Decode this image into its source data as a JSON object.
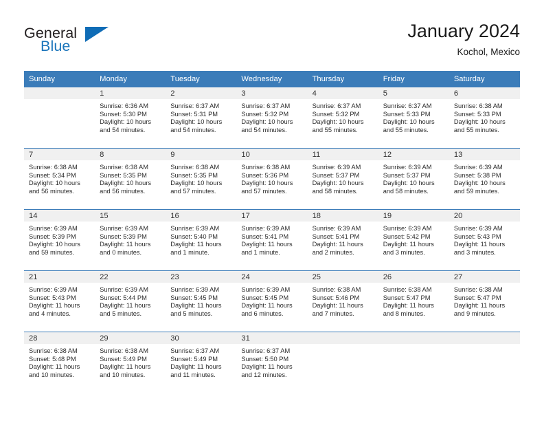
{
  "brand": {
    "name_part1": "General",
    "name_part2": "Blue",
    "logo_icon": "blue-triangle-icon"
  },
  "header": {
    "title": "January 2024",
    "subtitle": "Kochol, Mexico"
  },
  "calendar": {
    "weekday_headers": [
      "Sunday",
      "Monday",
      "Tuesday",
      "Wednesday",
      "Thursday",
      "Friday",
      "Saturday"
    ],
    "accent_color": "#3b7cb9",
    "daynum_band_color": "#f0f0f0",
    "weeks": [
      [
        {
          "day": "",
          "sunrise": "",
          "sunset": "",
          "daylight1": "",
          "daylight2": ""
        },
        {
          "day": "1",
          "sunrise": "Sunrise: 6:36 AM",
          "sunset": "Sunset: 5:30 PM",
          "daylight1": "Daylight: 10 hours",
          "daylight2": "and 54 minutes."
        },
        {
          "day": "2",
          "sunrise": "Sunrise: 6:37 AM",
          "sunset": "Sunset: 5:31 PM",
          "daylight1": "Daylight: 10 hours",
          "daylight2": "and 54 minutes."
        },
        {
          "day": "3",
          "sunrise": "Sunrise: 6:37 AM",
          "sunset": "Sunset: 5:32 PM",
          "daylight1": "Daylight: 10 hours",
          "daylight2": "and 54 minutes."
        },
        {
          "day": "4",
          "sunrise": "Sunrise: 6:37 AM",
          "sunset": "Sunset: 5:32 PM",
          "daylight1": "Daylight: 10 hours",
          "daylight2": "and 55 minutes."
        },
        {
          "day": "5",
          "sunrise": "Sunrise: 6:37 AM",
          "sunset": "Sunset: 5:33 PM",
          "daylight1": "Daylight: 10 hours",
          "daylight2": "and 55 minutes."
        },
        {
          "day": "6",
          "sunrise": "Sunrise: 6:38 AM",
          "sunset": "Sunset: 5:33 PM",
          "daylight1": "Daylight: 10 hours",
          "daylight2": "and 55 minutes."
        }
      ],
      [
        {
          "day": "7",
          "sunrise": "Sunrise: 6:38 AM",
          "sunset": "Sunset: 5:34 PM",
          "daylight1": "Daylight: 10 hours",
          "daylight2": "and 56 minutes."
        },
        {
          "day": "8",
          "sunrise": "Sunrise: 6:38 AM",
          "sunset": "Sunset: 5:35 PM",
          "daylight1": "Daylight: 10 hours",
          "daylight2": "and 56 minutes."
        },
        {
          "day": "9",
          "sunrise": "Sunrise: 6:38 AM",
          "sunset": "Sunset: 5:35 PM",
          "daylight1": "Daylight: 10 hours",
          "daylight2": "and 57 minutes."
        },
        {
          "day": "10",
          "sunrise": "Sunrise: 6:38 AM",
          "sunset": "Sunset: 5:36 PM",
          "daylight1": "Daylight: 10 hours",
          "daylight2": "and 57 minutes."
        },
        {
          "day": "11",
          "sunrise": "Sunrise: 6:39 AM",
          "sunset": "Sunset: 5:37 PM",
          "daylight1": "Daylight: 10 hours",
          "daylight2": "and 58 minutes."
        },
        {
          "day": "12",
          "sunrise": "Sunrise: 6:39 AM",
          "sunset": "Sunset: 5:37 PM",
          "daylight1": "Daylight: 10 hours",
          "daylight2": "and 58 minutes."
        },
        {
          "day": "13",
          "sunrise": "Sunrise: 6:39 AM",
          "sunset": "Sunset: 5:38 PM",
          "daylight1": "Daylight: 10 hours",
          "daylight2": "and 59 minutes."
        }
      ],
      [
        {
          "day": "14",
          "sunrise": "Sunrise: 6:39 AM",
          "sunset": "Sunset: 5:39 PM",
          "daylight1": "Daylight: 10 hours",
          "daylight2": "and 59 minutes."
        },
        {
          "day": "15",
          "sunrise": "Sunrise: 6:39 AM",
          "sunset": "Sunset: 5:39 PM",
          "daylight1": "Daylight: 11 hours",
          "daylight2": "and 0 minutes."
        },
        {
          "day": "16",
          "sunrise": "Sunrise: 6:39 AM",
          "sunset": "Sunset: 5:40 PM",
          "daylight1": "Daylight: 11 hours",
          "daylight2": "and 1 minute."
        },
        {
          "day": "17",
          "sunrise": "Sunrise: 6:39 AM",
          "sunset": "Sunset: 5:41 PM",
          "daylight1": "Daylight: 11 hours",
          "daylight2": "and 1 minute."
        },
        {
          "day": "18",
          "sunrise": "Sunrise: 6:39 AM",
          "sunset": "Sunset: 5:41 PM",
          "daylight1": "Daylight: 11 hours",
          "daylight2": "and 2 minutes."
        },
        {
          "day": "19",
          "sunrise": "Sunrise: 6:39 AM",
          "sunset": "Sunset: 5:42 PM",
          "daylight1": "Daylight: 11 hours",
          "daylight2": "and 3 minutes."
        },
        {
          "day": "20",
          "sunrise": "Sunrise: 6:39 AM",
          "sunset": "Sunset: 5:43 PM",
          "daylight1": "Daylight: 11 hours",
          "daylight2": "and 3 minutes."
        }
      ],
      [
        {
          "day": "21",
          "sunrise": "Sunrise: 6:39 AM",
          "sunset": "Sunset: 5:43 PM",
          "daylight1": "Daylight: 11 hours",
          "daylight2": "and 4 minutes."
        },
        {
          "day": "22",
          "sunrise": "Sunrise: 6:39 AM",
          "sunset": "Sunset: 5:44 PM",
          "daylight1": "Daylight: 11 hours",
          "daylight2": "and 5 minutes."
        },
        {
          "day": "23",
          "sunrise": "Sunrise: 6:39 AM",
          "sunset": "Sunset: 5:45 PM",
          "daylight1": "Daylight: 11 hours",
          "daylight2": "and 5 minutes."
        },
        {
          "day": "24",
          "sunrise": "Sunrise: 6:39 AM",
          "sunset": "Sunset: 5:45 PM",
          "daylight1": "Daylight: 11 hours",
          "daylight2": "and 6 minutes."
        },
        {
          "day": "25",
          "sunrise": "Sunrise: 6:38 AM",
          "sunset": "Sunset: 5:46 PM",
          "daylight1": "Daylight: 11 hours",
          "daylight2": "and 7 minutes."
        },
        {
          "day": "26",
          "sunrise": "Sunrise: 6:38 AM",
          "sunset": "Sunset: 5:47 PM",
          "daylight1": "Daylight: 11 hours",
          "daylight2": "and 8 minutes."
        },
        {
          "day": "27",
          "sunrise": "Sunrise: 6:38 AM",
          "sunset": "Sunset: 5:47 PM",
          "daylight1": "Daylight: 11 hours",
          "daylight2": "and 9 minutes."
        }
      ],
      [
        {
          "day": "28",
          "sunrise": "Sunrise: 6:38 AM",
          "sunset": "Sunset: 5:48 PM",
          "daylight1": "Daylight: 11 hours",
          "daylight2": "and 10 minutes."
        },
        {
          "day": "29",
          "sunrise": "Sunrise: 6:38 AM",
          "sunset": "Sunset: 5:49 PM",
          "daylight1": "Daylight: 11 hours",
          "daylight2": "and 10 minutes."
        },
        {
          "day": "30",
          "sunrise": "Sunrise: 6:37 AM",
          "sunset": "Sunset: 5:49 PM",
          "daylight1": "Daylight: 11 hours",
          "daylight2": "and 11 minutes."
        },
        {
          "day": "31",
          "sunrise": "Sunrise: 6:37 AM",
          "sunset": "Sunset: 5:50 PM",
          "daylight1": "Daylight: 11 hours",
          "daylight2": "and 12 minutes."
        },
        {
          "day": "",
          "sunrise": "",
          "sunset": "",
          "daylight1": "",
          "daylight2": ""
        },
        {
          "day": "",
          "sunrise": "",
          "sunset": "",
          "daylight1": "",
          "daylight2": ""
        },
        {
          "day": "",
          "sunrise": "",
          "sunset": "",
          "daylight1": "",
          "daylight2": ""
        }
      ]
    ]
  }
}
